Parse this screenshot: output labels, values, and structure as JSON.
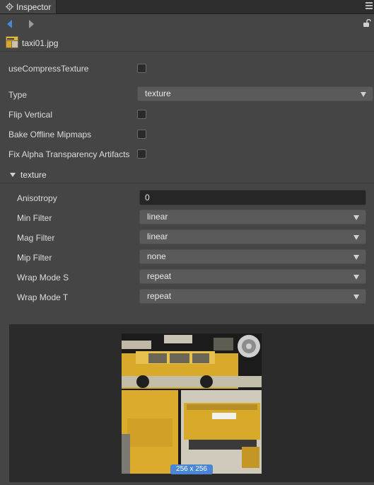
{
  "panel": {
    "tab_title": "Inspector"
  },
  "icons": {
    "tab": "gear-icon",
    "menu": "hamburger-menu-icon",
    "back": "arrow-left-icon",
    "forward": "arrow-right-icon",
    "lock": "unlock-icon",
    "file": "image-file-icon"
  },
  "colors": {
    "accent": "#4a86d4",
    "panel": "#454545",
    "input": "#262626"
  },
  "asset": {
    "name": "taxi01.jpg"
  },
  "properties": {
    "use_compress_texture": {
      "label": "useCompressTexture",
      "checked": false
    },
    "type": {
      "label": "Type",
      "value": "texture"
    },
    "flip_vertical": {
      "label": "Flip Vertical",
      "checked": false
    },
    "bake_offline_mipmaps": {
      "label": "Bake Offline Mipmaps",
      "checked": false
    },
    "fix_alpha": {
      "label": "Fix Alpha Transparency Artifacts",
      "checked": false
    }
  },
  "texture_section": {
    "title": "texture",
    "anisotropy": {
      "label": "Anisotropy",
      "value": "0"
    },
    "min_filter": {
      "label": "Min Filter",
      "value": "linear"
    },
    "mag_filter": {
      "label": "Mag Filter",
      "value": "linear"
    },
    "mip_filter": {
      "label": "Mip Filter",
      "value": "none"
    },
    "wrap_s": {
      "label": "Wrap Mode S",
      "value": "repeat"
    },
    "wrap_t": {
      "label": "Wrap Mode T",
      "value": "repeat"
    }
  },
  "preview": {
    "size_label": "256 x 256"
  }
}
